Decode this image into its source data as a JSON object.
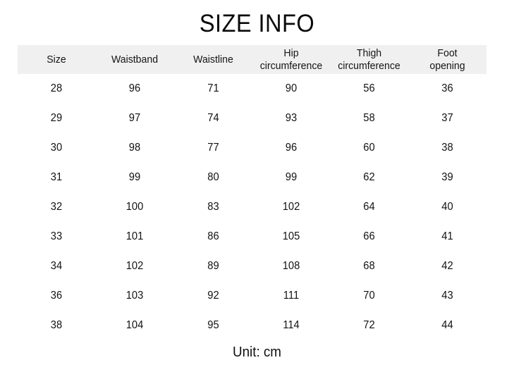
{
  "title": "SIZE INFO",
  "unit_note": "Unit: cm",
  "colors": {
    "header_background": "#f0f0f0",
    "page_background": "#ffffff",
    "text": "#111111"
  },
  "table": {
    "headers": [
      {
        "line1": "Size",
        "line2": ""
      },
      {
        "line1": "Waistband",
        "line2": ""
      },
      {
        "line1": "Waistline",
        "line2": ""
      },
      {
        "line1": "Hip",
        "line2": "circumference"
      },
      {
        "line1": "Thigh",
        "line2": "circumference"
      },
      {
        "line1": "Foot",
        "line2": "opening"
      }
    ],
    "rows": [
      {
        "size": "28",
        "waistband": "96",
        "waistline": "71",
        "hip": "90",
        "thigh": "56",
        "foot": "36"
      },
      {
        "size": "29",
        "waistband": "97",
        "waistline": "74",
        "hip": "93",
        "thigh": "58",
        "foot": "37"
      },
      {
        "size": "30",
        "waistband": "98",
        "waistline": "77",
        "hip": "96",
        "thigh": "60",
        "foot": "38"
      },
      {
        "size": "31",
        "waistband": "99",
        "waistline": "80",
        "hip": "99",
        "thigh": "62",
        "foot": "39"
      },
      {
        "size": "32",
        "waistband": "100",
        "waistline": "83",
        "hip": "102",
        "thigh": "64",
        "foot": "40"
      },
      {
        "size": "33",
        "waistband": "101",
        "waistline": "86",
        "hip": "105",
        "thigh": "66",
        "foot": "41"
      },
      {
        "size": "34",
        "waistband": "102",
        "waistline": "89",
        "hip": "108",
        "thigh": "68",
        "foot": "42"
      },
      {
        "size": "36",
        "waistband": "103",
        "waistline": "92",
        "hip": "111",
        "thigh": "70",
        "foot": "43"
      },
      {
        "size": "38",
        "waistband": "104",
        "waistline": "95",
        "hip": "114",
        "thigh": "72",
        "foot": "44"
      }
    ]
  }
}
